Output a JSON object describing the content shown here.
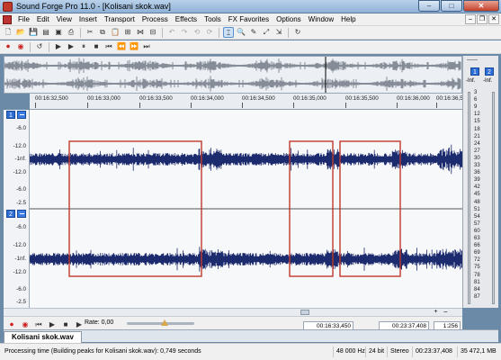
{
  "window": {
    "title": "Sound Forge Pro 11.0 - [Kolisani skok.wav]",
    "minimize": "–",
    "maximize": "□",
    "close": "✕"
  },
  "menu": [
    "File",
    "Edit",
    "View",
    "Insert",
    "Transport",
    "Process",
    "Effects",
    "Tools",
    "FX Favorites",
    "Options",
    "Window",
    "Help"
  ],
  "mdi_controls": [
    "–",
    "❐",
    "✕"
  ],
  "ruler_ticks": [
    "00:16:32,500",
    "00:16:33,000",
    "00:16:33,500",
    "00:16:34,000",
    "00:16:34,500",
    "00:16:35,000",
    "00:16:35,500",
    "00:16:36,000",
    "00:16:36,500"
  ],
  "channels": [
    {
      "id": "1",
      "scale": [
        "-6.0",
        "-12.0",
        "-1nf.",
        "-12.0",
        "-6.0",
        "-2.5"
      ]
    },
    {
      "id": "2",
      "scale": [
        "-6.0",
        "-12.0",
        "-1nf.",
        "-12.0",
        "-6.0",
        "-2.5"
      ]
    }
  ],
  "meter": {
    "top": "------",
    "channels": [
      "1",
      "2"
    ],
    "peaks": [
      "-Inf.",
      "-Inf."
    ],
    "scale": [
      "3",
      "6",
      "9",
      "12",
      "15",
      "18",
      "21",
      "24",
      "27",
      "30",
      "33",
      "36",
      "39",
      "42",
      "45",
      "48",
      "51",
      "54",
      "57",
      "60",
      "63",
      "66",
      "69",
      "72",
      "75",
      "78",
      "81",
      "84",
      "87"
    ]
  },
  "selection_boxes_count": 3,
  "transport": {
    "rate": "Rate: 0,00",
    "cursor_time": "00:16:33,450",
    "length_time": "00:23:37,408",
    "zoom": "1:256"
  },
  "tab": {
    "label": "Kolisani skok.wav"
  },
  "status": {
    "message": "Processing time (Building peaks for Kolisani skok.wav): 0,749 seconds",
    "rate": "48 000 Hz",
    "bits": "24 bit",
    "channels": "Stereo",
    "length": "00:23:37,408",
    "disk": "35 472,1 MB"
  },
  "colors": {
    "waveform": "#1c2a6e",
    "selection_box": "#c0392b",
    "channel_badge": "#2f6dd6"
  }
}
